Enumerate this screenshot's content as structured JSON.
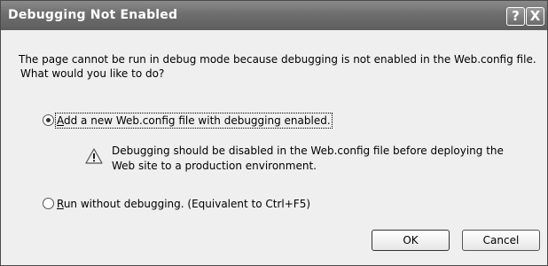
{
  "dialog": {
    "title": "Debugging Not Enabled",
    "help_glyph": "?",
    "close_glyph": "X",
    "message_line1": "The page cannot be run in debug mode because debugging is not enabled in the Web.config file.",
    "message_line2": "What would you like to do?",
    "options": [
      {
        "mnemonic": "A",
        "label_rest": "dd a new Web.config file with debugging enabled.",
        "selected": true
      },
      {
        "mnemonic": "R",
        "label_rest": "un without debugging. (Equivalent to Ctrl+F5)",
        "selected": false
      }
    ],
    "warning_line1": "Debugging should be disabled in the Web.config file before deploying the",
    "warning_line2": "Web site to a production environment.",
    "ok_label": "OK",
    "cancel_label": "Cancel",
    "icons": {
      "warning": "warning-icon",
      "help": "help-icon",
      "close": "close-icon"
    }
  }
}
